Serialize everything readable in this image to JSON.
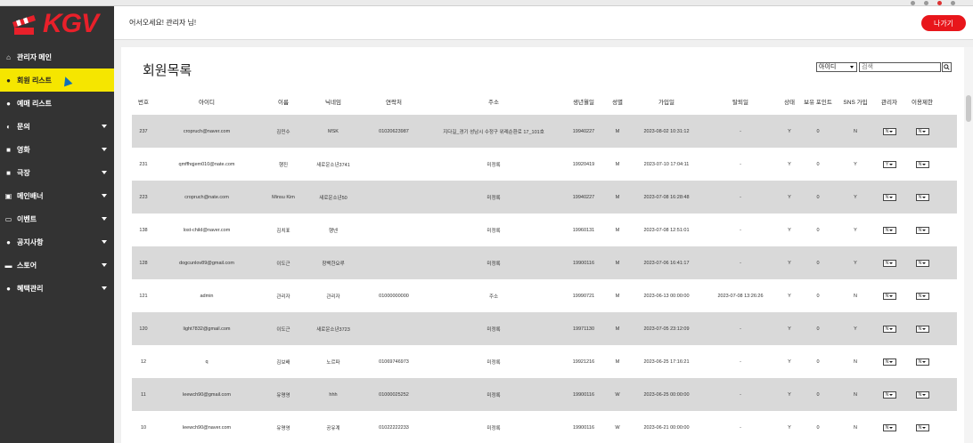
{
  "header": {
    "welcome": "어서오세요! 관리자 님!",
    "logout_label": "나가기"
  },
  "sidebar": {
    "brand": "KGV",
    "items": [
      {
        "label": "관리자 메인",
        "icon": "home-icon",
        "glyph": "⌂",
        "caret": false
      },
      {
        "label": "회원 리스트",
        "icon": "user-icon",
        "glyph": "●",
        "caret": false,
        "active": true
      },
      {
        "label": "예매 리스트",
        "icon": "user-icon",
        "glyph": "●",
        "caret": false
      },
      {
        "label": "문의",
        "icon": "headset-icon",
        "glyph": "◐",
        "caret": true
      },
      {
        "label": "영화",
        "icon": "film-icon",
        "glyph": "■",
        "caret": true
      },
      {
        "label": "극장",
        "icon": "film-icon",
        "glyph": "■",
        "caret": true
      },
      {
        "label": "메인배너",
        "icon": "banner-icon",
        "glyph": "▣",
        "caret": true
      },
      {
        "label": "이벤트",
        "icon": "event-icon",
        "glyph": "▭",
        "caret": true
      },
      {
        "label": "공지사항",
        "icon": "notice-icon",
        "glyph": "●",
        "caret": true
      },
      {
        "label": "스토어",
        "icon": "store-icon",
        "glyph": "▬",
        "caret": true
      },
      {
        "label": "혜택관리",
        "icon": "benefit-icon",
        "glyph": "●",
        "caret": true
      }
    ]
  },
  "main": {
    "title": "회원목록",
    "search": {
      "field_option": "아이디",
      "placeholder": "검색",
      "button_icon": "search-icon"
    },
    "columns": [
      "번호",
      "아이디",
      "이름",
      "닉네임",
      "연락처",
      "주소",
      "생년월일",
      "성별",
      "가입일",
      "탈퇴일",
      "상태",
      "보유 포인트",
      "SNS 가입",
      "관리자",
      "이용제한"
    ],
    "rows": [
      {
        "num": "237",
        "id": "cropruch@naver.com",
        "name": "김민수",
        "nick": "MSK",
        "phone": "01020623987",
        "addr": "지다길_경기 성남시 수정구 위례순환로 17_101호",
        "birth": "19940227",
        "gender": "M",
        "join": "2023-08-02 10:31:12",
        "quit": "-",
        "state": "Y",
        "point": "0",
        "sns": "N",
        "admin": "N",
        "limit": "N"
      },
      {
        "num": "231",
        "id": "qmffhqjem010@nate.com",
        "name": "행진",
        "nick": "새로운소년3741",
        "phone": "",
        "addr": "미정록",
        "birth": "19920419",
        "gender": "M",
        "join": "2023-07-10 17:04:11",
        "quit": "-",
        "state": "Y",
        "point": "0",
        "sns": "Y",
        "admin": "Y",
        "limit": "N"
      },
      {
        "num": "223",
        "id": "cropruch@nate.com",
        "name": "Minsu Kim",
        "nick": "새로운소년50",
        "phone": "",
        "addr": "미정록",
        "birth": "19940227",
        "gender": "M",
        "join": "2023-07-08 16:28:48",
        "quit": "-",
        "state": "Y",
        "point": "0",
        "sns": "Y",
        "admin": "N",
        "limit": "N"
      },
      {
        "num": "138",
        "id": "lost-child@naver.com",
        "name": "김치표",
        "nick": "행넨",
        "phone": "",
        "addr": "미정록",
        "birth": "19960131",
        "gender": "M",
        "join": "2023-07-08 12:51:01",
        "quit": "-",
        "state": "Y",
        "point": "0",
        "sns": "Y",
        "admin": "N",
        "limit": "N"
      },
      {
        "num": "128",
        "id": "dogcunlov89@gmail.com",
        "name": "이도근",
        "nick": "창백한요루",
        "phone": "",
        "addr": "미정록",
        "birth": "19900116",
        "gender": "M",
        "join": "2023-07-06 16:41:17",
        "quit": "-",
        "state": "Y",
        "point": "0",
        "sns": "Y",
        "admin": "N",
        "limit": "N"
      },
      {
        "num": "121",
        "id": "admin",
        "name": "관리자",
        "nick": "관리자",
        "phone": "01000000000",
        "addr": "주소",
        "birth": "19990721",
        "gender": "M",
        "join": "2023-06-13 00:00:00",
        "quit": "2023-07-08 13:26:26",
        "state": "Y",
        "point": "0",
        "sns": "N",
        "admin": "N",
        "limit": "N"
      },
      {
        "num": "120",
        "id": "light7832@gmail.com",
        "name": "이도근",
        "nick": "새로운소년3723",
        "phone": "",
        "addr": "미정록",
        "birth": "19971130",
        "gender": "M",
        "join": "2023-07-05 23:12:09",
        "quit": "-",
        "state": "Y",
        "point": "0",
        "sns": "Y",
        "admin": "N",
        "limit": "N"
      },
      {
        "num": "12",
        "id": "q",
        "name": "김보배",
        "nick": "노르파",
        "phone": "01069746973",
        "addr": "미정록",
        "birth": "19921216",
        "gender": "M",
        "join": "2023-06-25 17:16:21",
        "quit": "-",
        "state": "Y",
        "point": "0",
        "sns": "N",
        "admin": "N",
        "limit": "N"
      },
      {
        "num": "11",
        "id": "leewch90@gmail.com",
        "name": "유명영",
        "nick": "hhh",
        "phone": "01000025252",
        "addr": "미정록",
        "birth": "19900116",
        "gender": "W",
        "join": "2023-06-25 00:00:00",
        "quit": "-",
        "state": "Y",
        "point": "0",
        "sns": "N",
        "admin": "N",
        "limit": "N"
      },
      {
        "num": "10",
        "id": "leewch90@naver.com",
        "name": "유명영",
        "nick": "공유계",
        "phone": "01022222233",
        "addr": "미정록",
        "birth": "19900116",
        "gender": "W",
        "join": "2023-06-21 00:00:00",
        "quit": "-",
        "state": "Y",
        "point": "0",
        "sns": "N",
        "admin": "N",
        "limit": "N"
      }
    ]
  }
}
